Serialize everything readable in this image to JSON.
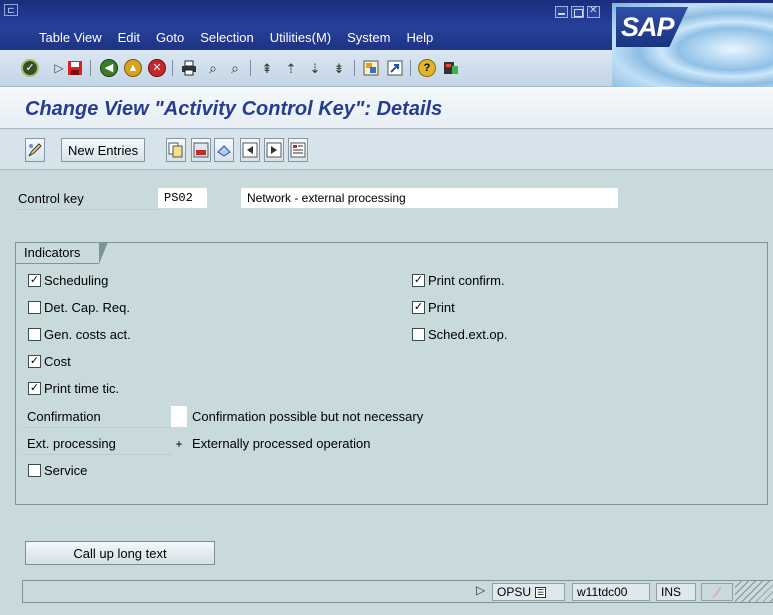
{
  "menu": {
    "items": [
      "Table View",
      "Edit",
      "Goto",
      "Selection",
      "Utilities(M)",
      "System",
      "Help"
    ]
  },
  "logo_text": "SAP",
  "toolbar": {
    "icons": [
      "enter-icon",
      "command-field-arrow-icon",
      "save-icon",
      "back-icon",
      "exit-icon",
      "cancel-icon",
      "print-icon",
      "find-icon",
      "find-next-icon",
      "first-page-icon",
      "previous-page-icon",
      "next-page-icon",
      "last-page-icon",
      "create-session-icon",
      "create-shortcut-icon",
      "help-icon",
      "layout-menu-icon"
    ]
  },
  "title": "Change View \"Activity Control Key\": Details",
  "app_toolbar": {
    "new_entries": "New Entries"
  },
  "control_key": {
    "label": "Control key",
    "value": "PS02",
    "description": "Network - external processing"
  },
  "indicators": {
    "title": "Indicators",
    "left": [
      {
        "label": "Scheduling",
        "checked": true
      },
      {
        "label": "Det. Cap. Req.",
        "checked": false
      },
      {
        "label": "Gen. costs act.",
        "checked": false
      },
      {
        "label": "Cost",
        "checked": true
      },
      {
        "label": "Print time tic.",
        "checked": true
      }
    ],
    "right": [
      {
        "label": "Print confirm.",
        "checked": true
      },
      {
        "label": "Print",
        "checked": true
      },
      {
        "label": "Sched.ext.op.",
        "checked": false
      }
    ],
    "confirmation": {
      "label": "Confirmation",
      "value": "",
      "text": "Confirmation possible but not necessary"
    },
    "ext_processing": {
      "label": "Ext. processing",
      "value": "+",
      "text": "Externally processed operation"
    },
    "service": {
      "label": "Service",
      "checked": false
    }
  },
  "long_text_button": "Call up long text",
  "status": {
    "transaction": "OPSU",
    "server": "w11tdc00",
    "mode": "INS"
  },
  "colors": {
    "title_blue": "#253d91",
    "menubar": "#1b2e7c",
    "work_bg": "#c9dadd"
  }
}
